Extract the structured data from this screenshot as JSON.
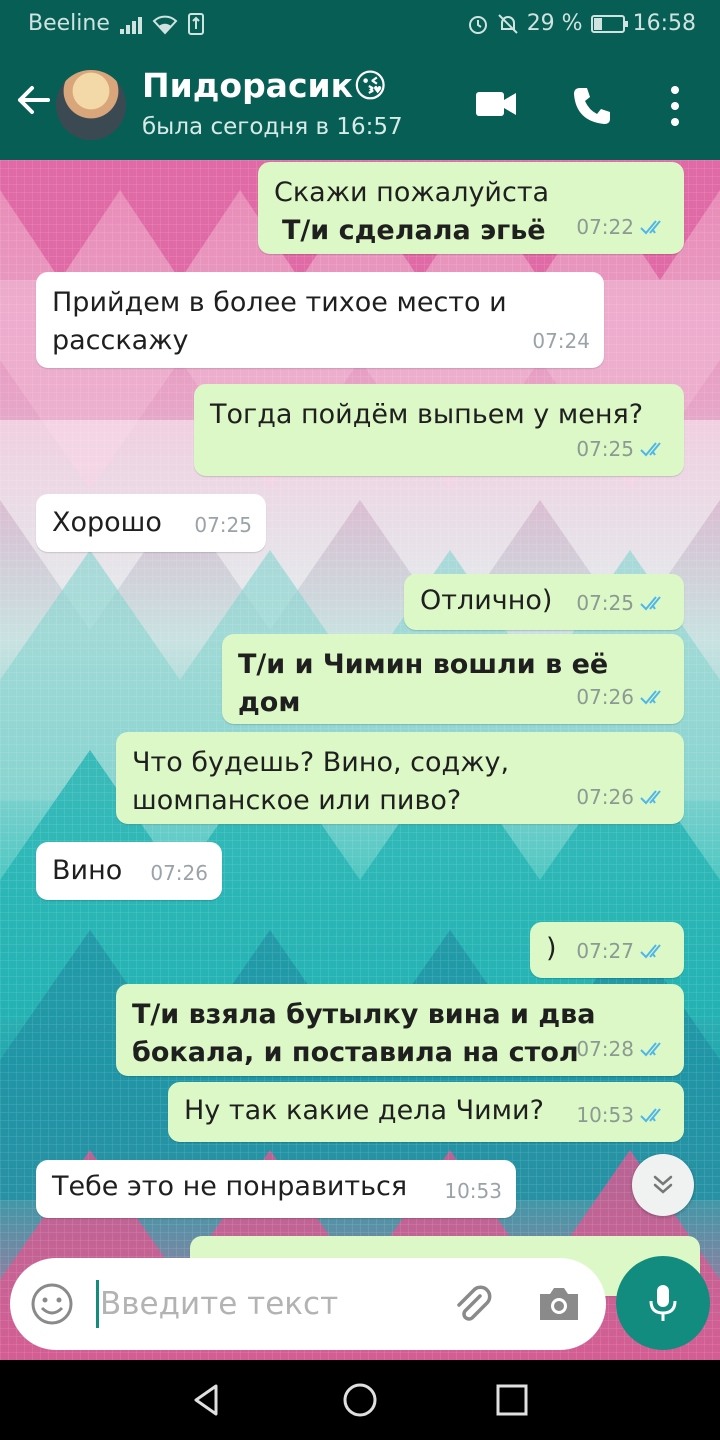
{
  "status_bar": {
    "carrier": "Beeline",
    "battery_percent": "29 %",
    "time": "16:58"
  },
  "header": {
    "contact_name": "Пидорасик😘",
    "last_seen": "была сегодня в 16:57"
  },
  "messages": [
    {
      "dir": "out",
      "lines": [
        "Скажи пожалуйста",
        "Т/и сделала эгьё"
      ],
      "bold_lines": [
        1
      ],
      "time": "07:22",
      "read": true
    },
    {
      "dir": "in",
      "lines": [
        "Прийдем в более тихое место и",
        "расскажу"
      ],
      "bold_lines": [],
      "time": "07:24"
    },
    {
      "dir": "out",
      "lines": [
        "Тогда пойдём выпьем у меня?"
      ],
      "bold_lines": [],
      "time": "07:25",
      "read": true
    },
    {
      "dir": "in",
      "lines": [
        "Хорошо"
      ],
      "bold_lines": [],
      "time": "07:25"
    },
    {
      "dir": "out",
      "lines": [
        "Отлично)"
      ],
      "bold_lines": [],
      "time": "07:25",
      "read": true
    },
    {
      "dir": "out",
      "lines": [
        "Т/и и Чимин вошли в её дом"
      ],
      "bold_lines": [
        0
      ],
      "time": "07:26",
      "read": true
    },
    {
      "dir": "out",
      "lines": [
        "Что будешь? Вино, соджу,",
        "шомпанское или пиво?"
      ],
      "bold_lines": [],
      "time": "07:26",
      "read": true
    },
    {
      "dir": "in",
      "lines": [
        "Вино"
      ],
      "bold_lines": [],
      "time": "07:26"
    },
    {
      "dir": "out",
      "lines": [
        ")"
      ],
      "bold_lines": [],
      "time": "07:27",
      "read": true
    },
    {
      "dir": "out",
      "lines": [
        "Т/и взяла бутылку вина и два",
        "бокала, и поставила на стол"
      ],
      "bold_lines": [
        0,
        1
      ],
      "time": "07:28",
      "read": true
    },
    {
      "dir": "out",
      "lines": [
        "Ну так какие дела Чими?"
      ],
      "bold_lines": [],
      "time": "10:53",
      "read": true
    },
    {
      "dir": "in",
      "lines": [
        "Тебе это не понравиться"
      ],
      "bold_lines": [],
      "time": "10:53"
    }
  ],
  "input": {
    "placeholder": "Введите текст",
    "value": ""
  },
  "colors": {
    "header": "#075e55",
    "outgoing_bubble": "#dcf8c6",
    "incoming_bubble": "#ffffff",
    "read_ticks": "#4fb6ec",
    "mic_button": "#128c7e"
  },
  "icons": [
    "back-arrow-icon",
    "video-call-icon",
    "phone-icon",
    "more-options-icon",
    "emoji-icon",
    "attach-icon",
    "camera-icon",
    "mic-icon",
    "scroll-down-icon"
  ]
}
